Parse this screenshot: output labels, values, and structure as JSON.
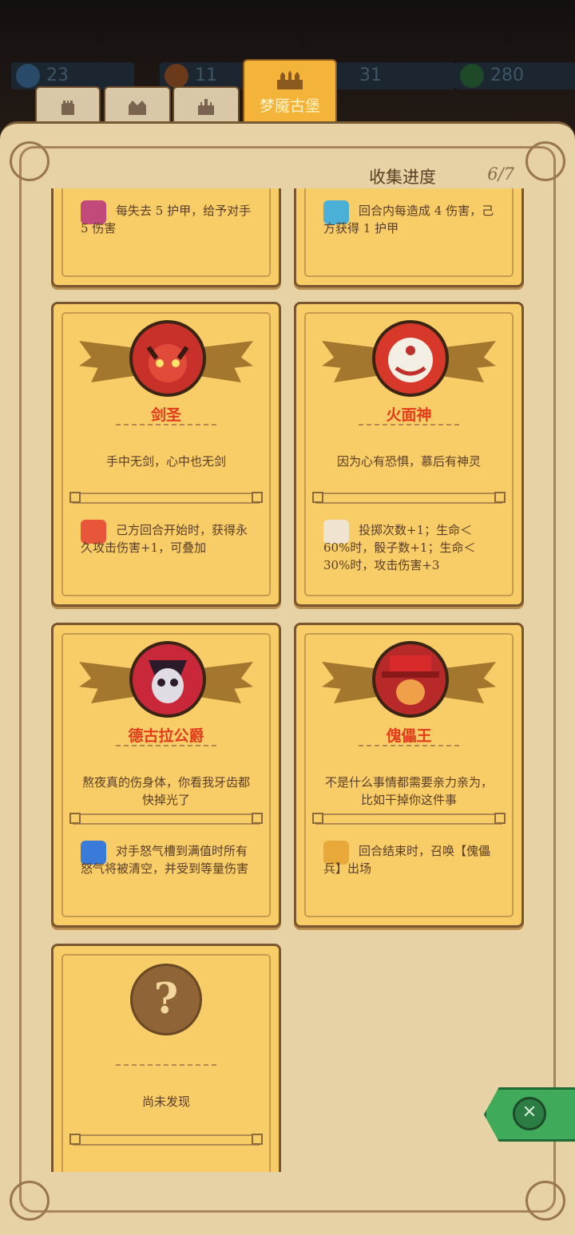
{
  "top_stats": [
    {
      "value": "23",
      "icon": "blue-gem-icon"
    },
    {
      "value": "11",
      "icon": "orange-coin-icon"
    },
    {
      "value": "31",
      "icon": "blue-crystal-icon"
    },
    {
      "value": "280",
      "icon": "green-gem-icon"
    }
  ],
  "tabs": [
    {
      "icon": "tower-icon",
      "label": ""
    },
    {
      "icon": "fort-icon",
      "label": ""
    },
    {
      "icon": "castle-icon",
      "label": ""
    },
    {
      "icon": "palace-icon",
      "label": "梦魇古堡",
      "active": true
    }
  ],
  "collection": {
    "label": "收集进度",
    "value": "6/7"
  },
  "cards": [
    {
      "name": "",
      "quote": "",
      "effect": "每失去 5 护甲，给予对手 5 伤害",
      "effect_icon": "shield-mask-icon",
      "portrait": "none"
    },
    {
      "name": "",
      "quote": "",
      "effect": "回合内每造成 4 伤害，己方获得 1 护甲",
      "effect_icon": "blue-badge-icon",
      "portrait": "none"
    },
    {
      "name": "剑圣",
      "quote": "手中无剑，心中也无剑",
      "effect": "己方回合开始时，获得永久攻击伤害+1，可叠加",
      "effect_icon": "flaming-sword-icon",
      "portrait": "red-samurai-portrait"
    },
    {
      "name": "火面神",
      "quote": "因为心有恐惧，慕后有神灵",
      "effect": "投掷次数+1；生命＜60%时，骰子数+1；生命＜30%时，攻击伤害+3",
      "effect_icon": "fire-face-icon",
      "portrait": "fire-face-portrait"
    },
    {
      "name": "德古拉公爵",
      "quote": "熬夜真的伤身体，你看我牙齿都快掉光了",
      "effect": "对手怒气槽到满值时所有怒气将被清空，并受到等量伤害",
      "effect_icon": "blue-wave-icon",
      "portrait": "dracula-portrait"
    },
    {
      "name": "傀儡王",
      "quote": "不是什么事情都需要亲力亲为，比如干掉你这件事",
      "effect": "回合结束时，召唤【傀儡兵】出场",
      "effect_icon": "puppet-icon",
      "portrait": "puppet-king-portrait"
    },
    {
      "name": "",
      "quote": "尚未发现",
      "effect": "",
      "effect_icon": "",
      "portrait": "unknown"
    }
  ],
  "colors": {
    "accent": "#f4b43a",
    "card": "#f8cc66",
    "name_red": "#e23c1c",
    "close_green": "#3eaa5a"
  }
}
